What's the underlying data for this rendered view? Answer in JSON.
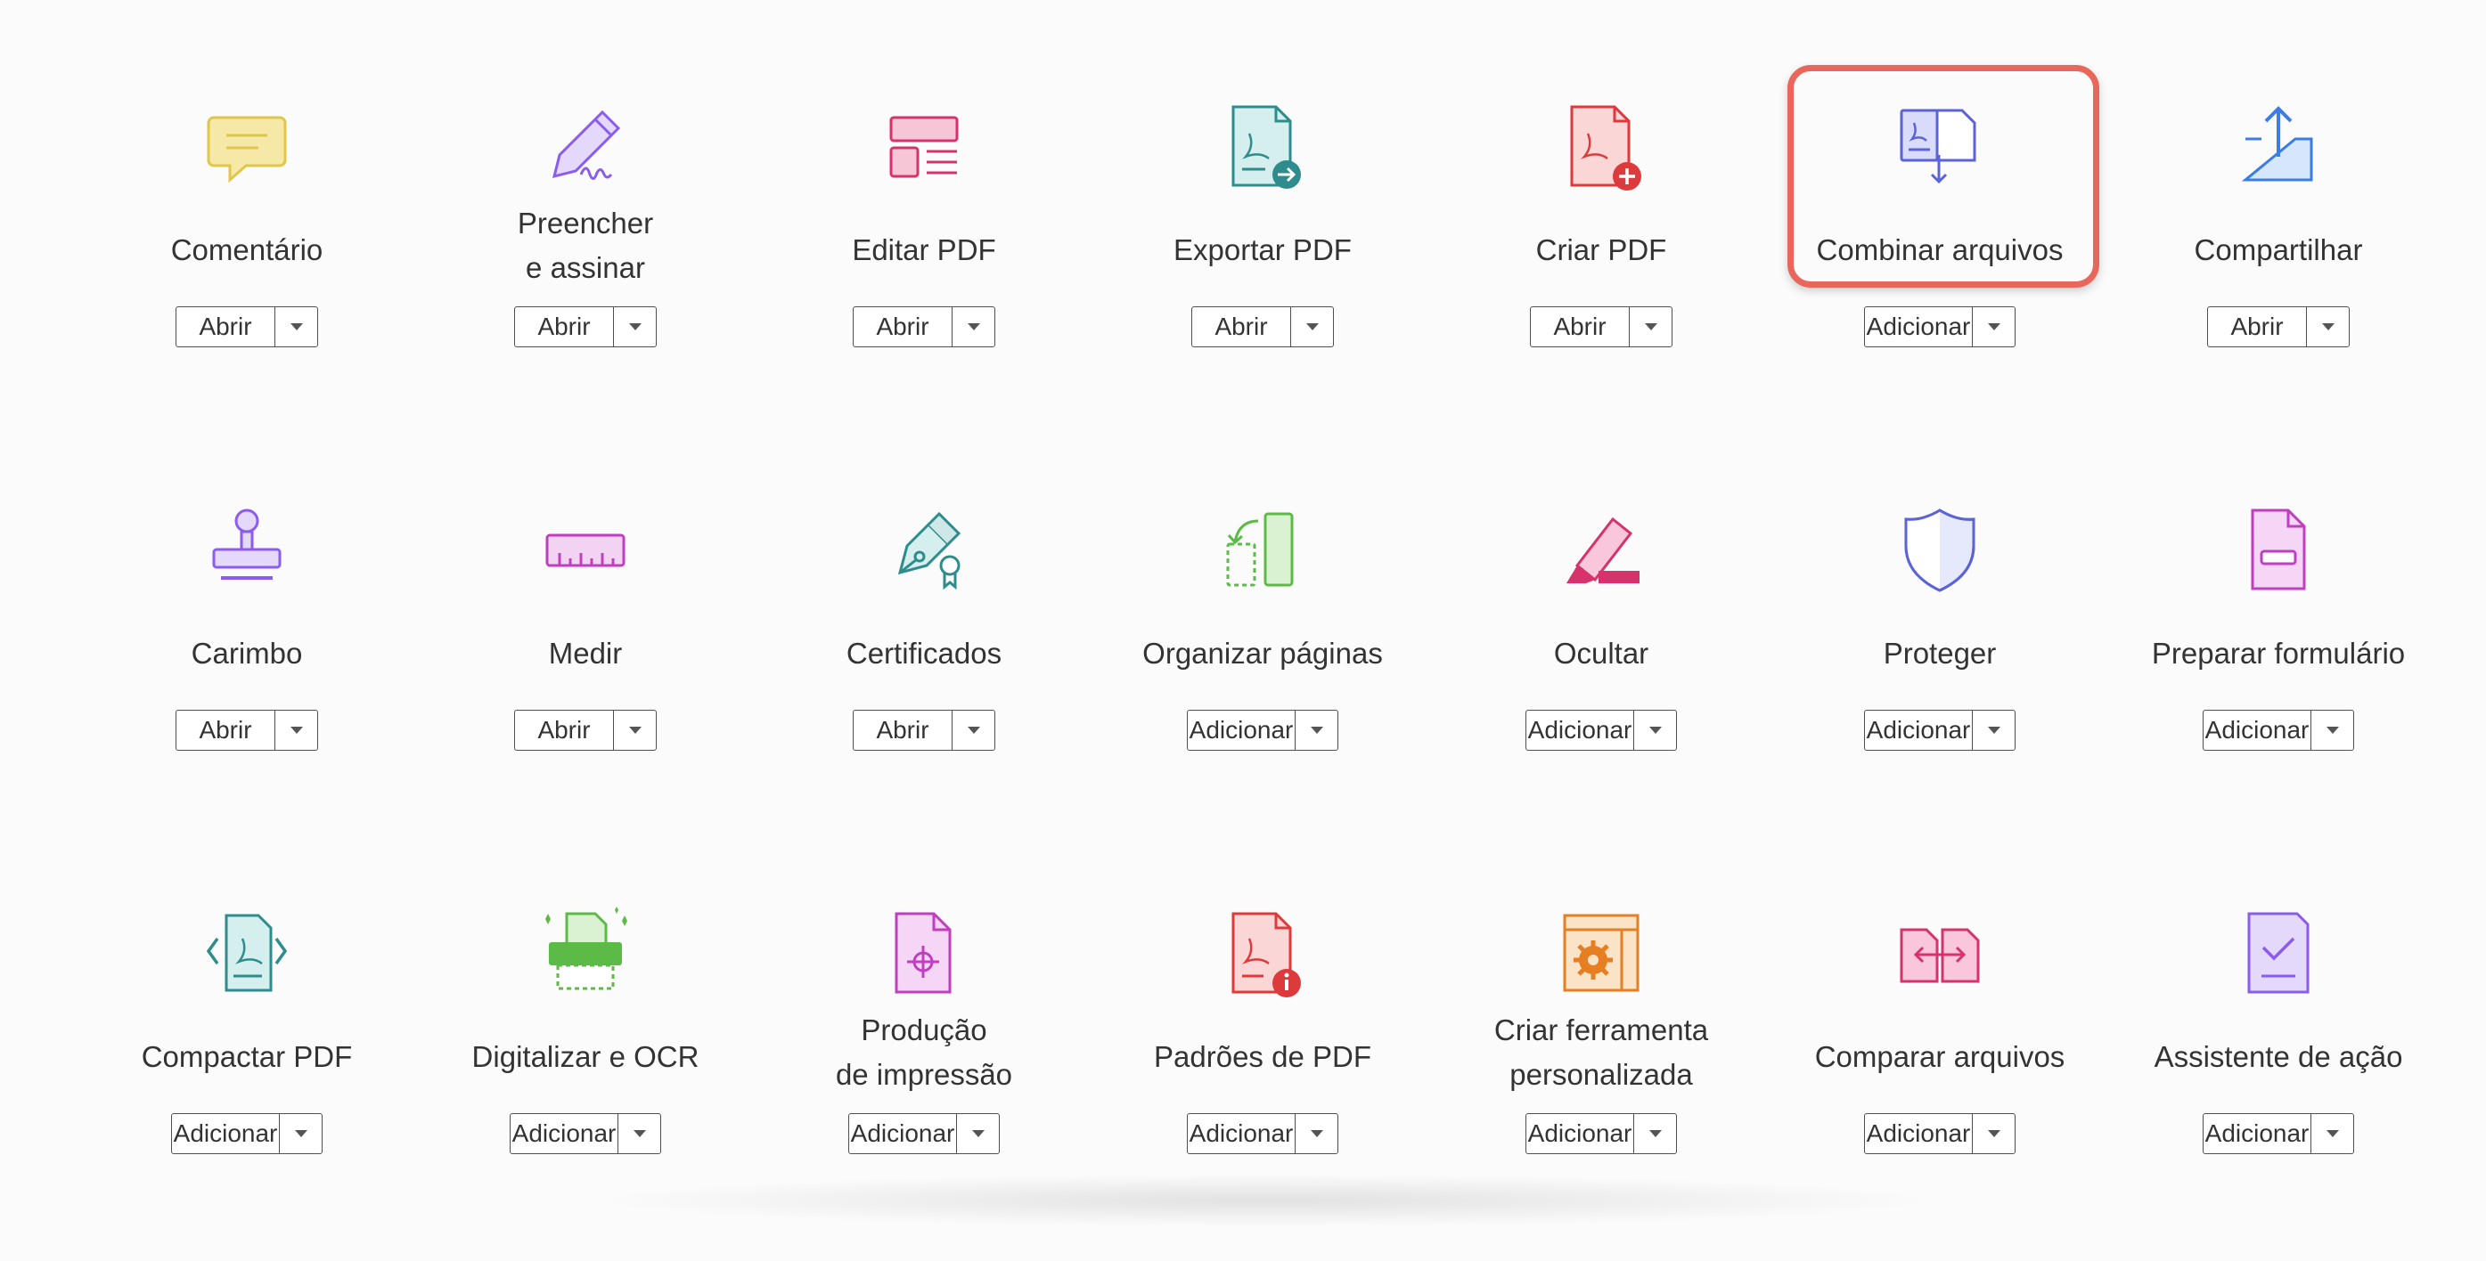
{
  "colors": {
    "highlight": "#e8665a",
    "yellow": "#e0c64a",
    "purple": "#8a5cf0",
    "pink": "#d6336c",
    "teal": "#2e8c8c",
    "red": "#dd3b3b",
    "blue": "#3b7ce6",
    "green": "#5cba47",
    "orange": "#e67e22"
  },
  "tools": [
    {
      "id": "comentario",
      "label": [
        "Comentário"
      ],
      "button": "Abrir",
      "icon": "comment-icon"
    },
    {
      "id": "preencher",
      "label": [
        "Preencher",
        "e assinar"
      ],
      "button": "Abrir",
      "icon": "pen-sign-icon"
    },
    {
      "id": "editar",
      "label": [
        "Editar PDF"
      ],
      "button": "Abrir",
      "icon": "edit-pdf-icon"
    },
    {
      "id": "exportar",
      "label": [
        "Exportar PDF"
      ],
      "button": "Abrir",
      "icon": "export-pdf-icon"
    },
    {
      "id": "criar",
      "label": [
        "Criar PDF"
      ],
      "button": "Abrir",
      "icon": "create-pdf-icon"
    },
    {
      "id": "combinar",
      "label": [
        "Combinar arquivos"
      ],
      "button": "Adicionar",
      "icon": "combine-files-icon",
      "highlighted": true
    },
    {
      "id": "compartilhar",
      "label": [
        "Compartilhar"
      ],
      "button": "Abrir",
      "icon": "share-icon"
    },
    {
      "id": "carimbo",
      "label": [
        "Carimbo"
      ],
      "button": "Abrir",
      "icon": "stamp-icon"
    },
    {
      "id": "medir",
      "label": [
        "Medir"
      ],
      "button": "Abrir",
      "icon": "ruler-icon"
    },
    {
      "id": "certificados",
      "label": [
        "Certificados"
      ],
      "button": "Abrir",
      "icon": "certificate-pen-icon"
    },
    {
      "id": "organizar",
      "label": [
        "Organizar páginas"
      ],
      "button": "Adicionar",
      "icon": "organize-pages-icon"
    },
    {
      "id": "ocultar",
      "label": [
        "Ocultar"
      ],
      "button": "Adicionar",
      "icon": "redact-marker-icon"
    },
    {
      "id": "proteger",
      "label": [
        "Proteger"
      ],
      "button": "Adicionar",
      "icon": "shield-icon"
    },
    {
      "id": "preparar",
      "label": [
        "Preparar formulário"
      ],
      "button": "Adicionar",
      "icon": "prepare-form-icon"
    },
    {
      "id": "compactar",
      "label": [
        "Compactar PDF"
      ],
      "button": "Adicionar",
      "icon": "compress-pdf-icon"
    },
    {
      "id": "digitalizar",
      "label": [
        "Digitalizar e OCR"
      ],
      "button": "Adicionar",
      "icon": "scanner-icon"
    },
    {
      "id": "producao",
      "label": [
        "Produção",
        "de impressão"
      ],
      "button": "Adicionar",
      "icon": "print-production-icon"
    },
    {
      "id": "padroes",
      "label": [
        "Padrões de PDF"
      ],
      "button": "Adicionar",
      "icon": "pdf-standards-icon"
    },
    {
      "id": "criar-ferramenta",
      "label": [
        "Criar ferramenta",
        "personalizada"
      ],
      "button": "Adicionar",
      "icon": "custom-tool-gear-icon"
    },
    {
      "id": "comparar",
      "label": [
        "Comparar arquivos"
      ],
      "button": "Adicionar",
      "icon": "compare-files-icon"
    },
    {
      "id": "assistente",
      "label": [
        "Assistente de ação"
      ],
      "button": "Adicionar",
      "icon": "action-wizard-icon"
    }
  ]
}
